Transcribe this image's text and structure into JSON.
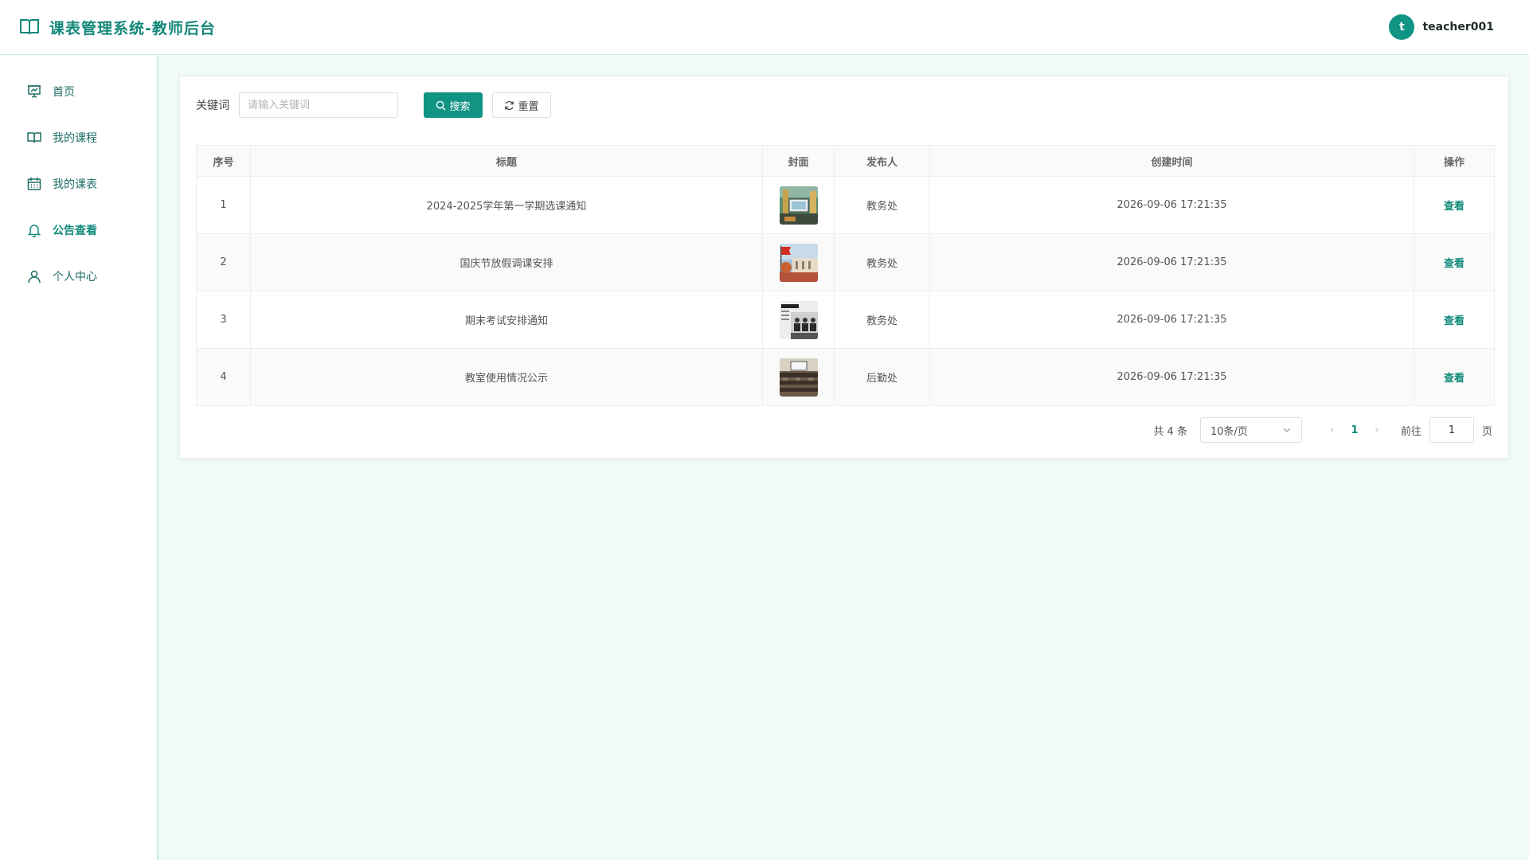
{
  "app": {
    "title": "课表管理系统-教师后台"
  },
  "user": {
    "avatar_letter": "t",
    "name": "teacher001"
  },
  "sidebar": {
    "items": [
      {
        "label": "首页",
        "icon": "presentation-icon"
      },
      {
        "label": "我的课程",
        "icon": "book-icon"
      },
      {
        "label": "我的课表",
        "icon": "calendar-icon"
      },
      {
        "label": "公告查看",
        "icon": "bell-icon",
        "active": true
      },
      {
        "label": "个人中心",
        "icon": "user-icon"
      }
    ]
  },
  "search": {
    "label": "关键词",
    "placeholder": "请输入关键词",
    "value": "",
    "search_button": "搜索",
    "reset_button": "重置"
  },
  "table": {
    "headers": [
      "序号",
      "标题",
      "封面",
      "发布人",
      "创建时间",
      "操作"
    ],
    "rows": [
      {
        "index": "1",
        "title": "2024-2025学年第一学期选课通知",
        "publisher": "教务处",
        "created": "2026-09-06 17:21:35",
        "action": "查看"
      },
      {
        "index": "2",
        "title": "国庆节放假调课安排",
        "publisher": "教务处",
        "created": "2026-09-06 17:21:35",
        "action": "查看"
      },
      {
        "index": "3",
        "title": "期末考试安排通知",
        "publisher": "教务处",
        "created": "2026-09-06 17:21:35",
        "action": "查看"
      },
      {
        "index": "4",
        "title": "教室使用情况公示",
        "publisher": "后勤处",
        "created": "2026-09-06 17:21:35",
        "action": "查看"
      }
    ]
  },
  "pagination": {
    "total": "共 4 条",
    "page_size": "10条/页",
    "current_page": "1",
    "goto_label": "前往",
    "goto_value": "1",
    "page_unit": "页"
  },
  "colors": {
    "accent": "#129484",
    "background": "#f0faf8"
  }
}
